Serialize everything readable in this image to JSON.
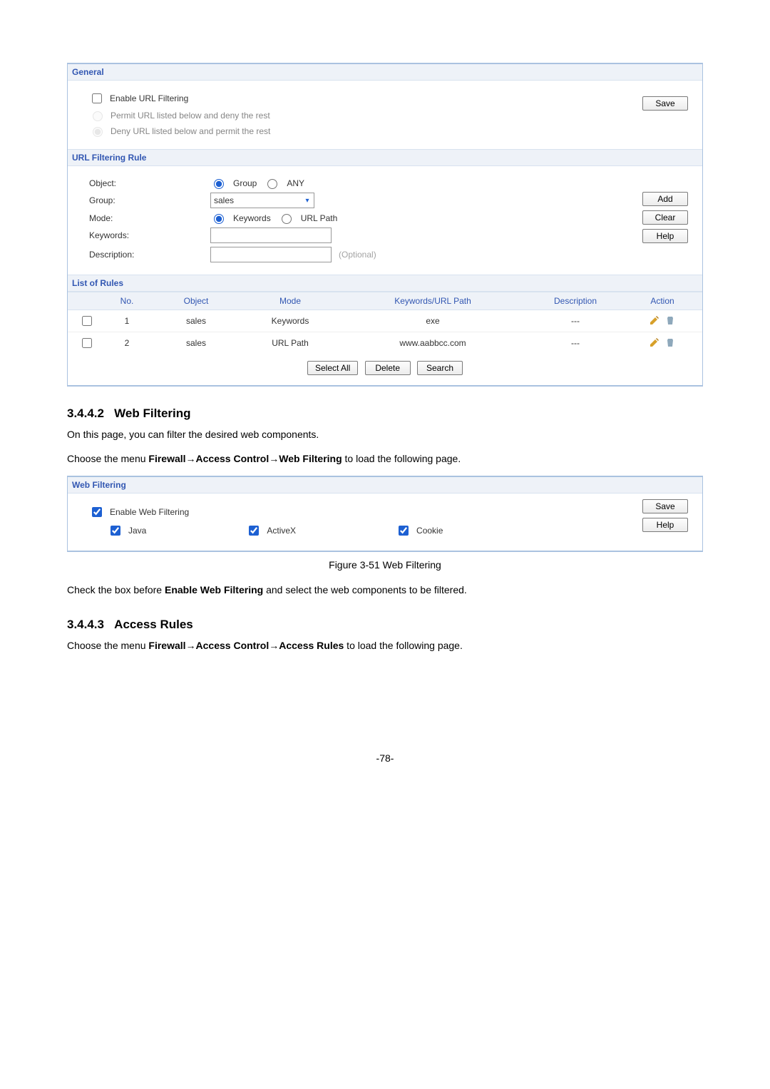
{
  "panel1": {
    "general": {
      "title": "General",
      "enable_label": "Enable URL Filtering",
      "permit_label": "Permit URL listed below and deny the rest",
      "deny_label": "Deny URL listed below and permit the rest",
      "save": "Save"
    },
    "ruleForm": {
      "title": "URL Filtering Rule",
      "object_label": "Object:",
      "object_group": "Group",
      "object_any": "ANY",
      "group_label": "Group:",
      "group_value": "sales",
      "mode_label": "Mode:",
      "mode_keywords": "Keywords",
      "mode_urlpath": "URL Path",
      "keywords_label": "Keywords:",
      "desc_label": "Description:",
      "desc_placeholder": "(Optional)",
      "add": "Add",
      "clear": "Clear",
      "help": "Help"
    },
    "list": {
      "title": "List of Rules",
      "cols": {
        "no": "No.",
        "object": "Object",
        "mode": "Mode",
        "kurl": "Keywords/URL Path",
        "desc": "Description",
        "action": "Action"
      },
      "rows": [
        {
          "no": "1",
          "object": "sales",
          "mode": "Keywords",
          "kurl": "exe",
          "desc": "---"
        },
        {
          "no": "2",
          "object": "sales",
          "mode": "URL Path",
          "kurl": "www.aabbcc.com",
          "desc": "---"
        }
      ],
      "select_all": "Select All",
      "delete": "Delete",
      "search": "Search"
    }
  },
  "doc": {
    "h_webfilter_num": "3.4.4.2",
    "h_webfilter": "Web Filtering",
    "p_webfilter_intro": "On this page, you can filter the desired web components.",
    "p_webfilter_nav_prefix": "Choose the menu ",
    "p_webfilter_nav_bold": "Firewall→Access Control→Web Filtering",
    "p_webfilter_nav_suffix": " to load the following page.",
    "fig_caption": "Figure 3-51 Web Filtering",
    "p_webfilter_check_prefix": "Check the box before ",
    "p_webfilter_check_bold": "Enable Web Filtering",
    "p_webfilter_check_suffix": " and select the web components to be filtered.",
    "h_access_num": "3.4.4.3",
    "h_access": "Access Rules",
    "p_access_nav_prefix": "Choose the menu ",
    "p_access_nav_bold": "Firewall→Access Control→Access Rules",
    "p_access_nav_suffix": " to load the following page.",
    "page_num": "-78-"
  },
  "panel2": {
    "title": "Web Filtering",
    "enable": "Enable Web Filtering",
    "java": "Java",
    "activex": "ActiveX",
    "cookie": "Cookie",
    "save": "Save",
    "help": "Help"
  }
}
